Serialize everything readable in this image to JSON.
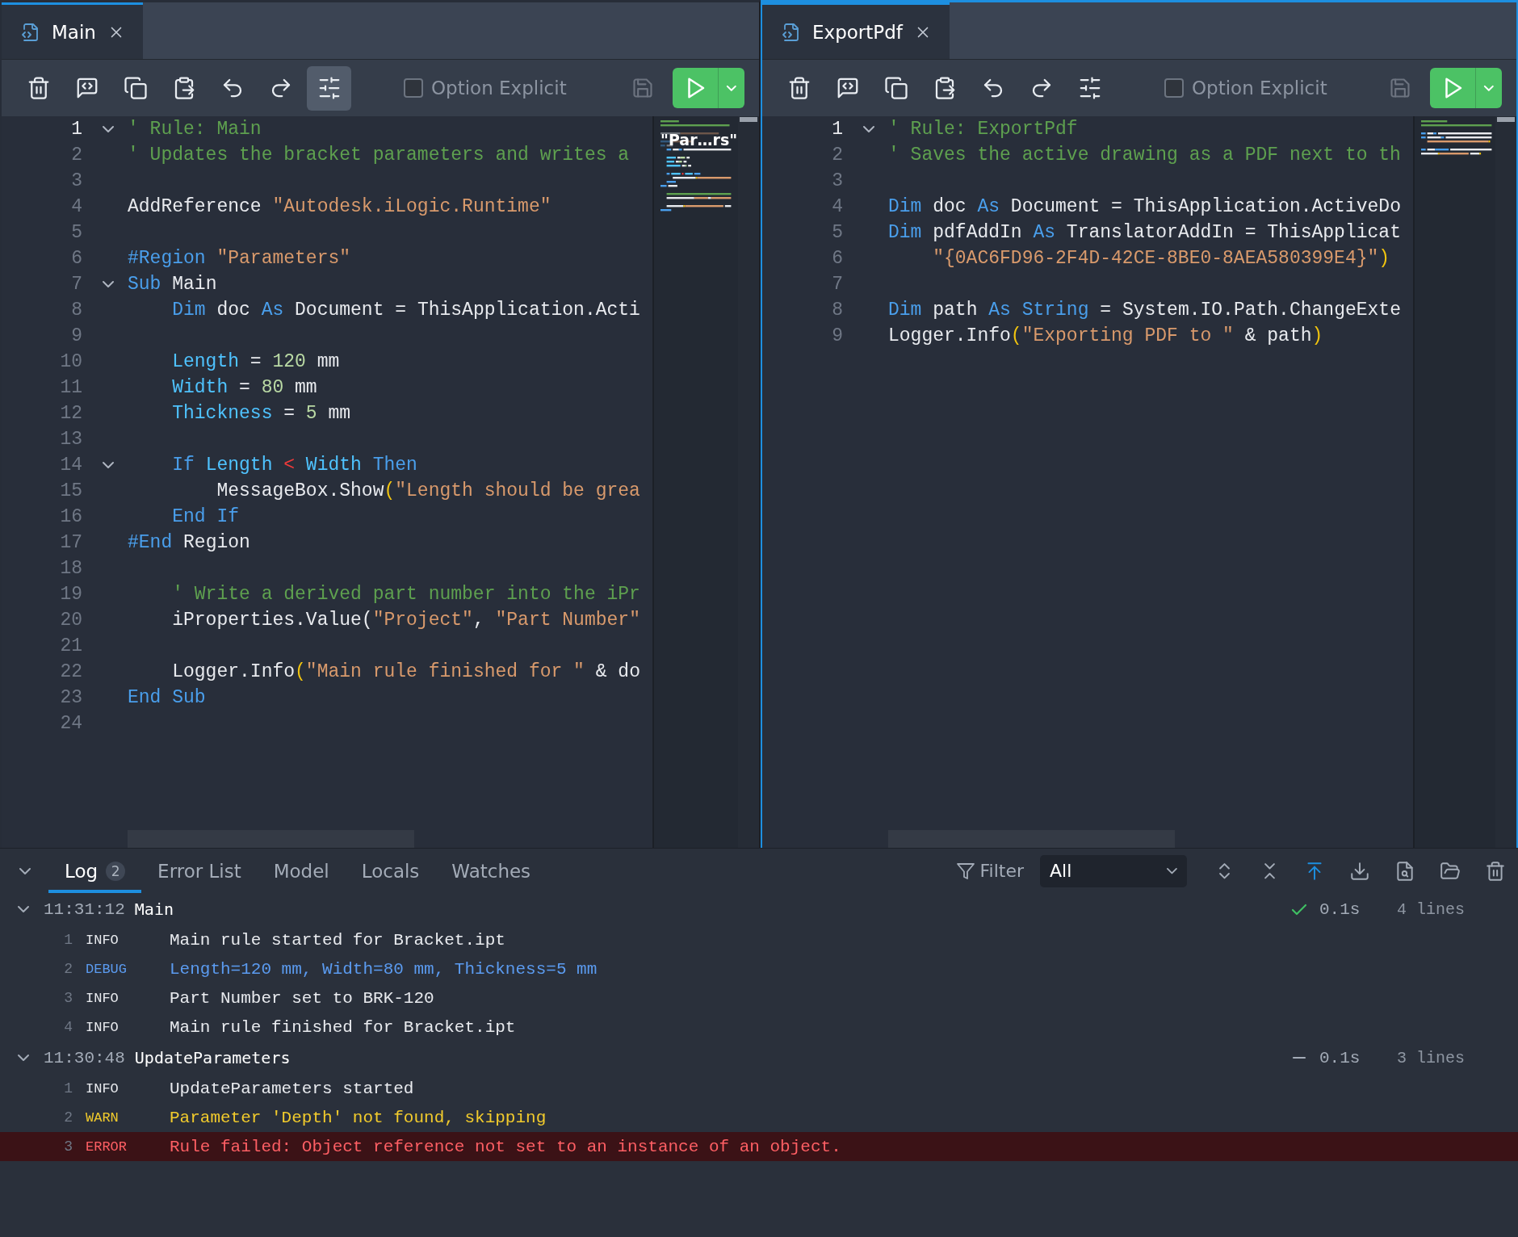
{
  "editors": [
    {
      "focused": false,
      "tab": {
        "title": "Main",
        "selected": true
      },
      "toolbar": {
        "settings_active": true,
        "option_explicit": {
          "label": "Option Explicit",
          "checked": false
        },
        "save_disabled": true
      },
      "lines": [
        {
          "number": "1",
          "current": true,
          "expanded": true,
          "tokens": [
            {
              "kind": "comment",
              "text": "' Rule: Main"
            }
          ]
        },
        {
          "number": "2",
          "tokens": [
            {
              "kind": "comment",
              "text": "' Updates the bracket parameters and writes a"
            }
          ]
        },
        {
          "number": "3"
        },
        {
          "number": "4",
          "tokens": [
            {
              "kind": "plain",
              "text": "AddReference "
            },
            {
              "kind": "string",
              "text": "\"Autodesk.iLogic.Runtime\""
            }
          ]
        },
        {
          "number": "5"
        },
        {
          "number": "6",
          "tokens": [
            {
              "kind": "keyword",
              "text": "#Region"
            },
            {
              "kind": "string",
              "text": " \"Parameters\""
            }
          ]
        },
        {
          "number": "7",
          "expanded": true,
          "tokens": [
            {
              "kind": "keyword",
              "text": "Sub"
            },
            {
              "kind": "plain",
              "text": " Main"
            }
          ]
        },
        {
          "number": "8",
          "tokens": [
            {
              "kind": "keyword",
              "text": "    Dim"
            },
            {
              "kind": "plain",
              "text": " doc "
            },
            {
              "kind": "keyword",
              "text": "As"
            },
            {
              "kind": "plain",
              "text": " Document = ThisApplication.Acti"
            }
          ]
        },
        {
          "number": "9"
        },
        {
          "number": "10",
          "tokens": [
            {
              "kind": "param",
              "text": "    Length"
            },
            {
              "kind": "plain",
              "text": " = "
            },
            {
              "kind": "number",
              "text": "120"
            },
            {
              "kind": "plain",
              "text": " mm"
            }
          ]
        },
        {
          "number": "11",
          "tokens": [
            {
              "kind": "param",
              "text": "    Width"
            },
            {
              "kind": "plain",
              "text": " = "
            },
            {
              "kind": "number",
              "text": "80"
            },
            {
              "kind": "plain",
              "text": " mm"
            }
          ]
        },
        {
          "number": "12",
          "tokens": [
            {
              "kind": "param",
              "text": "    Thickness"
            },
            {
              "kind": "plain",
              "text": " = "
            },
            {
              "kind": "number",
              "text": "5"
            },
            {
              "kind": "plain",
              "text": " mm"
            }
          ]
        },
        {
          "number": "13"
        },
        {
          "number": "14",
          "expanded": true,
          "tokens": [
            {
              "kind": "keyword",
              "text": "    If"
            },
            {
              "kind": "param",
              "text": " Length"
            },
            {
              "kind": "operator",
              "text": " <"
            },
            {
              "kind": "param",
              "text": " Width"
            },
            {
              "kind": "keyword",
              "text": " Then"
            }
          ]
        },
        {
          "number": "15",
          "tokens": [
            {
              "kind": "plain",
              "text": "        MessageBox.Show"
            },
            {
              "kind": "bracket",
              "text": "("
            },
            {
              "kind": "string",
              "text": "\"Length should be grea"
            }
          ]
        },
        {
          "number": "16",
          "tokens": [
            {
              "kind": "keyword",
              "text": "    End If"
            }
          ]
        },
        {
          "number": "17",
          "tokens": [
            {
              "kind": "keyword",
              "text": "#End"
            },
            {
              "kind": "plain",
              "text": " Region"
            }
          ]
        },
        {
          "number": "18"
        },
        {
          "number": "19",
          "tokens": [
            {
              "kind": "comment",
              "text": "    ' Write a derived part number into the iPr"
            }
          ]
        },
        {
          "number": "20",
          "tokens": [
            {
              "kind": "plain",
              "text": "    iProperties.Value("
            },
            {
              "kind": "string",
              "text": "\"Project\""
            },
            {
              "kind": "plain",
              "text": ", "
            },
            {
              "kind": "string",
              "text": "\"Part Number\""
            }
          ]
        },
        {
          "number": "21"
        },
        {
          "number": "22",
          "tokens": [
            {
              "kind": "plain",
              "text": "    Logger.Info"
            },
            {
              "kind": "bracket",
              "text": "("
            },
            {
              "kind": "string",
              "text": "\"Main rule finished for \""
            },
            {
              "kind": "plain",
              "text": " & do"
            }
          ]
        },
        {
          "number": "23",
          "tokens": [
            {
              "kind": "keyword",
              "text": "End Sub"
            }
          ]
        },
        {
          "number": "24"
        }
      ],
      "minimap_tooltip": "\"Par…rs\""
    },
    {
      "focused": true,
      "tab": {
        "title": "ExportPdf",
        "selected": true
      },
      "toolbar": {
        "settings_active": false,
        "option_explicit": {
          "label": "Option Explicit",
          "checked": false
        },
        "save_disabled": true
      },
      "lines": [
        {
          "number": "1",
          "current": true,
          "expanded": true,
          "tokens": [
            {
              "kind": "comment",
              "text": "' Rule: ExportPdf"
            }
          ]
        },
        {
          "number": "2",
          "tokens": [
            {
              "kind": "comment",
              "text": "' Saves the active drawing as a PDF next to th"
            }
          ]
        },
        {
          "number": "3"
        },
        {
          "number": "4",
          "tokens": [
            {
              "kind": "keyword",
              "text": "Dim"
            },
            {
              "kind": "plain",
              "text": " doc "
            },
            {
              "kind": "keyword",
              "text": "As"
            },
            {
              "kind": "plain",
              "text": " Document = ThisApplication.ActiveDo"
            }
          ]
        },
        {
          "number": "5",
          "tokens": [
            {
              "kind": "keyword",
              "text": "Dim"
            },
            {
              "kind": "plain",
              "text": " pdfAddIn "
            },
            {
              "kind": "keyword",
              "text": "As"
            },
            {
              "kind": "plain",
              "text": " TranslatorAddIn = ThisApplicat"
            }
          ]
        },
        {
          "number": "6",
          "tokens": [
            {
              "kind": "string",
              "text": "    \"{0AC6FD96-2F4D-42CE-8BE0-8AEA580399E4}\""
            },
            {
              "kind": "bracket",
              "text": ")"
            }
          ]
        },
        {
          "number": "7"
        },
        {
          "number": "8",
          "tokens": [
            {
              "kind": "keyword",
              "text": "Dim"
            },
            {
              "kind": "plain",
              "text": " path "
            },
            {
              "kind": "keyword",
              "text": "As String"
            },
            {
              "kind": "plain",
              "text": " = System.IO.Path.ChangeExte"
            }
          ]
        },
        {
          "number": "9",
          "tokens": [
            {
              "kind": "plain",
              "text": "Logger.Info"
            },
            {
              "kind": "bracket",
              "text": "("
            },
            {
              "kind": "string",
              "text": "\"Exporting PDF to \""
            },
            {
              "kind": "plain",
              "text": " & path"
            },
            {
              "kind": "bracket",
              "text": ")"
            }
          ]
        }
      ]
    }
  ],
  "output": {
    "expanded": true,
    "tabs": [
      {
        "label": "Log",
        "badge": "2",
        "selected": true
      },
      {
        "label": "Error List",
        "selected": false
      },
      {
        "label": "Model",
        "selected": false
      },
      {
        "label": "Locals",
        "selected": false
      },
      {
        "label": "Watches",
        "selected": false
      }
    ],
    "filter": {
      "label": "Filter",
      "value": "All"
    },
    "scroll_to_top_active": true,
    "groups": [
      {
        "expanded": true,
        "time": "11:31:12",
        "rule": "Main",
        "kind": "success",
        "duration": "0.1s",
        "count": "4 lines",
        "entries": [
          {
            "number": "1",
            "level": "INFO",
            "kind": "info",
            "message": "Main rule started for Bracket.ipt"
          },
          {
            "number": "2",
            "level": "DEBUG",
            "kind": "debug",
            "message": "Length=120 mm, Width=80 mm, Thickness=5 mm"
          },
          {
            "number": "3",
            "level": "INFO",
            "kind": "info",
            "message": "Part Number set to BRK-120"
          },
          {
            "number": "4",
            "level": "INFO",
            "kind": "info",
            "message": "Main rule finished for Bracket.ipt"
          }
        ]
      },
      {
        "expanded": true,
        "time": "11:30:48",
        "rule": "UpdateParameters",
        "kind": "neutral",
        "duration": "0.1s",
        "count": "3 lines",
        "entries": [
          {
            "number": "1",
            "level": "INFO",
            "kind": "info",
            "message": "UpdateParameters started"
          },
          {
            "number": "2",
            "level": "WARN",
            "kind": "warn",
            "message": "Parameter 'Depth' not found, skipping"
          },
          {
            "number": "3",
            "level": "ERROR",
            "kind": "error",
            "message": "Rule failed: Object reference not set to an instance of an object."
          }
        ]
      }
    ]
  }
}
